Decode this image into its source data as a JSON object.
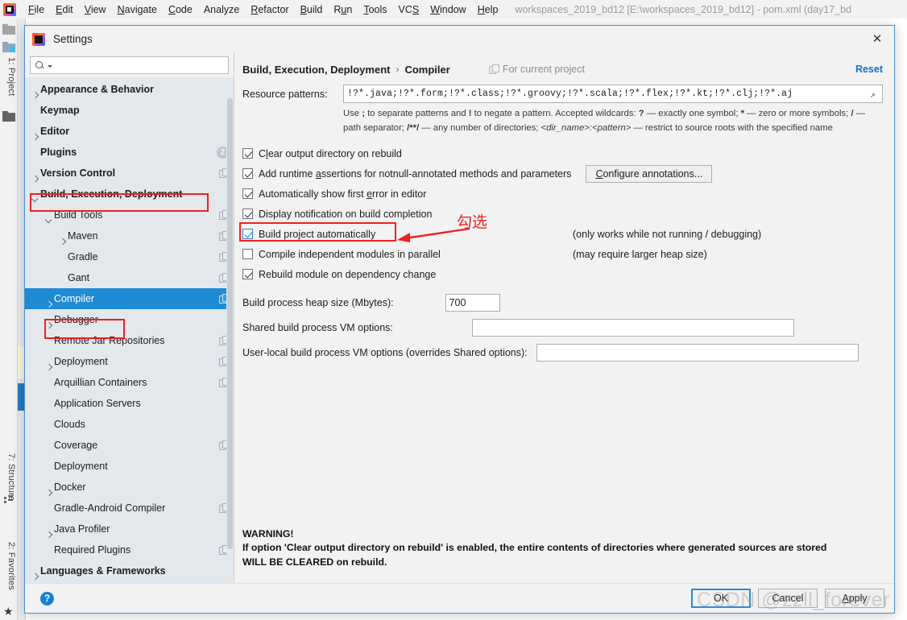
{
  "ide": {
    "menus": [
      {
        "label": "File",
        "mnemonic": "F"
      },
      {
        "label": "Edit",
        "mnemonic": "E"
      },
      {
        "label": "View",
        "mnemonic": "V"
      },
      {
        "label": "Navigate",
        "mnemonic": "N"
      },
      {
        "label": "Code",
        "mnemonic": "C"
      },
      {
        "label": "Analyze",
        "mnemonic": ""
      },
      {
        "label": "Refactor",
        "mnemonic": "R"
      },
      {
        "label": "Build",
        "mnemonic": "B"
      },
      {
        "label": "Run",
        "mnemonic": "u"
      },
      {
        "label": "Tools",
        "mnemonic": "T"
      },
      {
        "label": "VCS",
        "mnemonic": "S"
      },
      {
        "label": "Window",
        "mnemonic": "W"
      },
      {
        "label": "Help",
        "mnemonic": "H"
      }
    ],
    "window_title": "workspaces_2019_bd12 [E:\\workspaces_2019_bd12] - pom.xml (day17_bd",
    "toolwindows": {
      "project": "1: Project",
      "structure": "7: Structure",
      "favorites": "2: Favorites"
    }
  },
  "dialog": {
    "title": "Settings",
    "close_label": "✕"
  },
  "search": {
    "value": "",
    "placeholder": ""
  },
  "tree": [
    {
      "label": "Appearance & Behavior",
      "indent": 0,
      "arrow": "right",
      "bold": true,
      "badge": "",
      "modicon": false,
      "selected": false
    },
    {
      "label": "Keymap",
      "indent": 0,
      "arrow": "none",
      "bold": true,
      "badge": "",
      "modicon": false,
      "selected": false
    },
    {
      "label": "Editor",
      "indent": 0,
      "arrow": "right",
      "bold": true,
      "badge": "",
      "modicon": false,
      "selected": false
    },
    {
      "label": "Plugins",
      "indent": 0,
      "arrow": "none",
      "bold": true,
      "badge": "2",
      "modicon": false,
      "selected": false
    },
    {
      "label": "Version Control",
      "indent": 0,
      "arrow": "right",
      "bold": true,
      "badge": "",
      "modicon": true,
      "selected": false
    },
    {
      "label": "Build, Execution, Deployment",
      "indent": 0,
      "arrow": "down",
      "bold": true,
      "badge": "",
      "modicon": false,
      "selected": false
    },
    {
      "label": "Build Tools",
      "indent": 1,
      "arrow": "down",
      "bold": false,
      "badge": "",
      "modicon": true,
      "selected": false
    },
    {
      "label": "Maven",
      "indent": 2,
      "arrow": "right",
      "bold": false,
      "badge": "",
      "modicon": true,
      "selected": false
    },
    {
      "label": "Gradle",
      "indent": 2,
      "arrow": "none",
      "bold": false,
      "badge": "",
      "modicon": true,
      "selected": false
    },
    {
      "label": "Gant",
      "indent": 2,
      "arrow": "none",
      "bold": false,
      "badge": "",
      "modicon": true,
      "selected": false
    },
    {
      "label": "Compiler",
      "indent": 1,
      "arrow": "right",
      "bold": false,
      "badge": "",
      "modicon": true,
      "selected": true
    },
    {
      "label": "Debugger",
      "indent": 1,
      "arrow": "right",
      "bold": false,
      "badge": "",
      "modicon": false,
      "selected": false
    },
    {
      "label": "Remote Jar Repositories",
      "indent": 1,
      "arrow": "none",
      "bold": false,
      "badge": "",
      "modicon": true,
      "selected": false
    },
    {
      "label": "Deployment",
      "indent": 1,
      "arrow": "right",
      "bold": false,
      "badge": "",
      "modicon": true,
      "selected": false
    },
    {
      "label": "Arquillian Containers",
      "indent": 1,
      "arrow": "none",
      "bold": false,
      "badge": "",
      "modicon": true,
      "selected": false
    },
    {
      "label": "Application Servers",
      "indent": 1,
      "arrow": "none",
      "bold": false,
      "badge": "",
      "modicon": false,
      "selected": false
    },
    {
      "label": "Clouds",
      "indent": 1,
      "arrow": "none",
      "bold": false,
      "badge": "",
      "modicon": false,
      "selected": false
    },
    {
      "label": "Coverage",
      "indent": 1,
      "arrow": "none",
      "bold": false,
      "badge": "",
      "modicon": true,
      "selected": false
    },
    {
      "label": "Deployment",
      "indent": 1,
      "arrow": "none",
      "bold": false,
      "badge": "",
      "modicon": false,
      "selected": false
    },
    {
      "label": "Docker",
      "indent": 1,
      "arrow": "right",
      "bold": false,
      "badge": "",
      "modicon": false,
      "selected": false
    },
    {
      "label": "Gradle-Android Compiler",
      "indent": 1,
      "arrow": "none",
      "bold": false,
      "badge": "",
      "modicon": true,
      "selected": false
    },
    {
      "label": "Java Profiler",
      "indent": 1,
      "arrow": "right",
      "bold": false,
      "badge": "",
      "modicon": false,
      "selected": false
    },
    {
      "label": "Required Plugins",
      "indent": 1,
      "arrow": "none",
      "bold": false,
      "badge": "",
      "modicon": true,
      "selected": false
    },
    {
      "label": "Languages & Frameworks",
      "indent": 0,
      "arrow": "right",
      "bold": true,
      "badge": "",
      "modicon": false,
      "selected": false
    }
  ],
  "main": {
    "breadcrumb_root": "Build, Execution, Deployment",
    "breadcrumb_sep": "›",
    "breadcrumb_leaf": "Compiler",
    "for_current_project": "For current project",
    "reset_label": "Reset",
    "resource_patterns_label": "Resource patterns:",
    "resource_patterns_value": "!?*.java;!?*.form;!?*.class;!?*.groovy;!?*.scala;!?*.flex;!?*.kt;!?*.clj;!?*.aj",
    "hint_line1_pre": "Use ",
    "hint": "Use ; to separate patterns and ! to negate a pattern. Accepted wildcards: ? — exactly one symbol; * — zero or more symbols; / — path separator; /**/ — any number of directories; <dir_name>:<pattern> — restrict to source roots with the specified name",
    "checkboxes": [
      {
        "label": "Clear output directory on rebuild",
        "mnemonic": "l",
        "checked": true,
        "note": "",
        "highlight": false,
        "button": ""
      },
      {
        "label": "Add runtime assertions for notnull-annotated methods and parameters",
        "mnemonic": "a",
        "checked": true,
        "note": "",
        "highlight": false,
        "button": "Configure annotations..."
      },
      {
        "label": "Automatically show first error in editor",
        "mnemonic": "e",
        "checked": true,
        "note": "",
        "highlight": false,
        "button": ""
      },
      {
        "label": "Display notification on build completion",
        "mnemonic": "",
        "checked": true,
        "note": "",
        "highlight": false,
        "button": ""
      },
      {
        "label": "Build project automatically",
        "mnemonic": "",
        "checked": true,
        "note": "(only works while not running / debugging)",
        "highlight": true,
        "button": ""
      },
      {
        "label": "Compile independent modules in parallel",
        "mnemonic": "",
        "checked": false,
        "note": "(may require larger heap size)",
        "highlight": false,
        "button": ""
      },
      {
        "label": "Rebuild module on dependency change",
        "mnemonic": "",
        "checked": true,
        "note": "",
        "highlight": false,
        "button": ""
      }
    ],
    "heap_label": "Build process heap size (Mbytes):",
    "heap_value": "700",
    "shared_vm_label": "Shared build process VM options:",
    "shared_vm_value": "",
    "userlocal_vm_label": "User-local build process VM options (overrides Shared options):",
    "userlocal_vm_value": "",
    "warning_title": "WARNING!",
    "warning_line1": "If option 'Clear output directory on rebuild' is enabled, the entire contents of directories where generated sources are stored",
    "warning_line2": "WILL BE CLEARED on rebuild."
  },
  "annotation": {
    "chinese_text": "勾选",
    "color": "#ee2020"
  },
  "footer": {
    "help_label": "?",
    "ok_label": "OK",
    "cancel_label": "Cancel",
    "apply_label": "Apply",
    "apply_mnemonic": "A",
    "watermark": "CSDN @zzll_forever"
  },
  "colors": {
    "selection_blue": "#1f8bd4",
    "link_blue": "#1a6fc4",
    "annotation_red": "#ee2020",
    "tree_bg": "#e3e8ec",
    "panel_bg": "#f2f2f2"
  }
}
